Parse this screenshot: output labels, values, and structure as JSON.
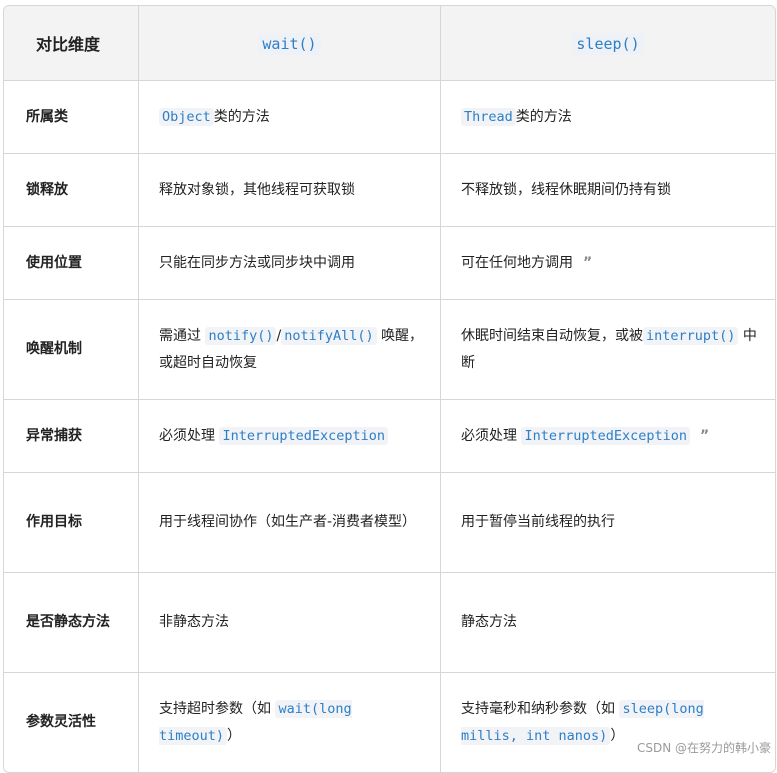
{
  "header": {
    "dimension": "对比维度",
    "wait": "wait()",
    "sleep": "sleep()"
  },
  "rows": [
    {
      "dim": "所属类",
      "wait": {
        "code": "Object",
        "text": "类的方法"
      },
      "sleep": {
        "code": "Thread",
        "text": "类的方法"
      }
    },
    {
      "dim": "锁释放",
      "wait": "释放对象锁，其他线程可获取锁",
      "sleep": "不释放锁，线程休眠期间仍持有锁"
    },
    {
      "dim": "使用位置",
      "wait": "只能在同步方法或同步块中调用",
      "sleep": "可在任何地方调用"
    },
    {
      "dim": "唤醒机制",
      "wait": {
        "pre": "需通过",
        "code1": "notify()",
        "sep": "/",
        "code2": "notifyAll()",
        "post": "唤醒，或超时自动恢复"
      },
      "sleep": {
        "pre": "休眠时间结束自动恢复，或被",
        "code": "interrupt()",
        "post": "中断"
      }
    },
    {
      "dim": "异常捕获",
      "wait": {
        "pre": "必须处理",
        "code": "InterruptedException"
      },
      "sleep": {
        "pre": "必须处理",
        "code": "InterruptedException"
      }
    },
    {
      "dim": "作用目标",
      "wait": "用于线程间协作（如生产者-消费者模型）",
      "sleep": "用于暂停当前线程的执行"
    },
    {
      "dim": "是否静态方法",
      "wait": "非静态方法",
      "sleep": "静态方法"
    },
    {
      "dim": "参数灵活性",
      "wait": {
        "pre": "支持超时参数（如",
        "code": "wait(long timeout)",
        "post": "）"
      },
      "sleep": {
        "pre": "支持毫秒和纳秒参数（如",
        "code": "sleep(long millis, int nanos)",
        "post": "）"
      }
    }
  ],
  "quote_glyph": "”",
  "watermark": "CSDN @在努力的韩小豪"
}
